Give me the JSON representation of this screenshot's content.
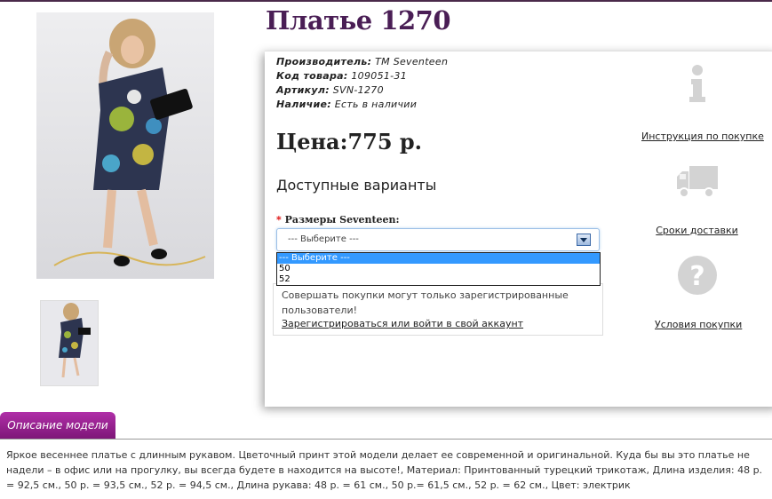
{
  "product": {
    "title": "Платье 1270",
    "manufacturer_label": "Производитель:",
    "manufacturer": "ТМ Seventeen",
    "code_label": "Код товара:",
    "code": "109051-31",
    "sku_label": "Артикул:",
    "sku": "SVN-1270",
    "availability_label": "Наличие:",
    "availability": "Есть в наличии",
    "price": "Цена:775 р."
  },
  "variants": {
    "heading": "Доступные варианты",
    "required_star": "*",
    "size_label": "Размеры Seventeen:",
    "selected": "--- Выберите ---",
    "options": [
      "--- Выберите ---",
      "50",
      "52"
    ]
  },
  "notice": {
    "text": "Совершать покупки могут только зарегистрированные пользователи!",
    "link": "Зарегистрироваться или войти в свой аккаунт"
  },
  "sidebar": {
    "instructions": "Инструкция по покупке",
    "delivery": "Сроки доставки",
    "terms": "Условия покупки"
  },
  "tab": {
    "label": "Описание модели"
  },
  "description": {
    "text": "Яркое весеннее платье с длинным рукавом. Цветочный принт этой модели делает ее современной и оригинальной. Куда бы вы это платье не надели – в офис или на прогулку, вы всегда будете в находится на высоте!, Материал: Принтованный турецкий трикотаж, Длина изделия: 48 р. = 92,5 см., 50 р. = 93,5 см., 52 р. = 94,5 см., Длина рукава: 48 р. = 61 см., 50 р.= 61,5 см., 52 р. = 62 см., Цвет: электрик"
  },
  "colors": {
    "title": "#4a1e55",
    "tab": "#9a239a",
    "dropdown_selected": "#3399ff"
  }
}
